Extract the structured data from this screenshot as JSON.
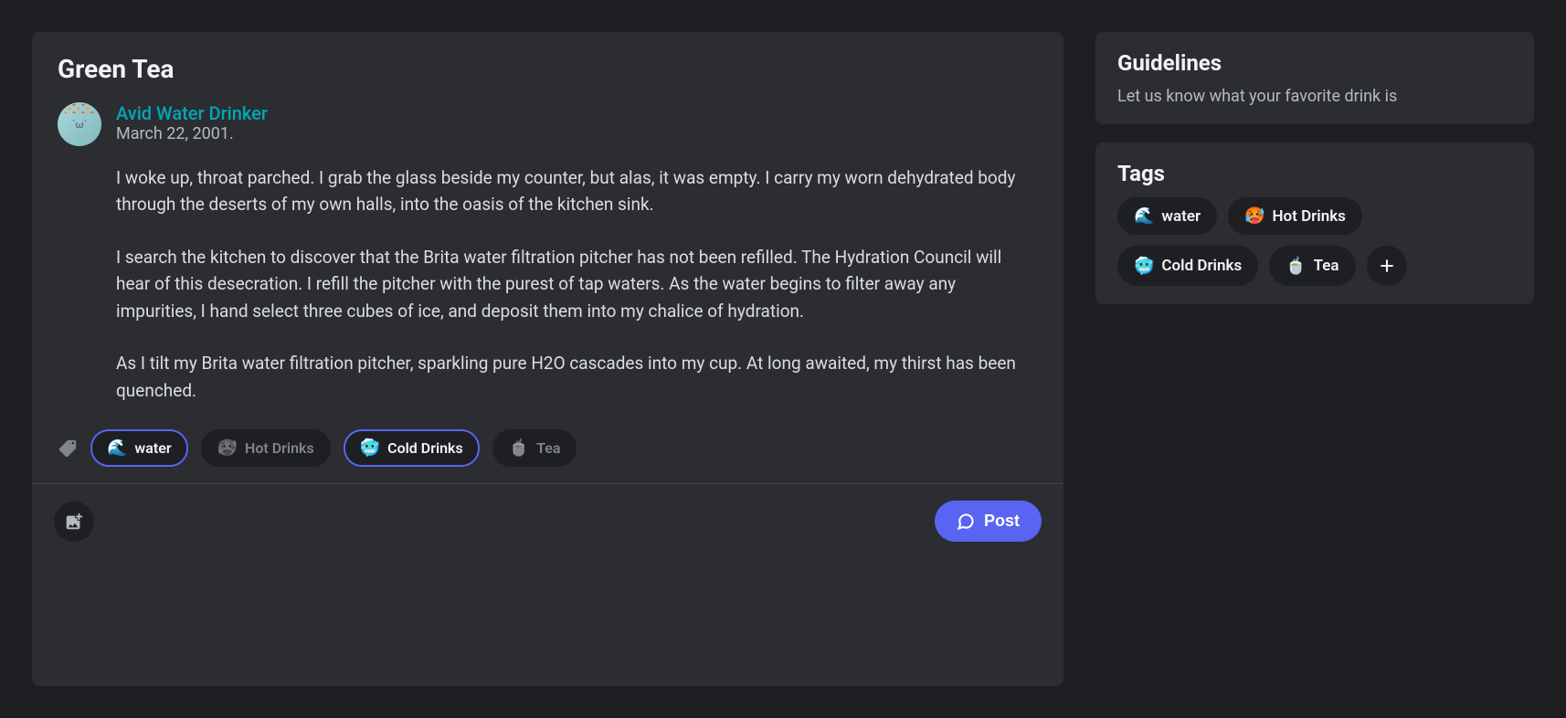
{
  "post": {
    "title": "Green Tea",
    "author": "Avid Water Drinker",
    "date": "March 22, 2001.",
    "paragraphs": [
      "I woke up, throat parched. I grab the glass beside my counter, but alas, it was empty. I carry my worn dehydrated body through the deserts of my own halls, into the oasis of the kitchen sink.",
      "I search the kitchen to discover that the Brita water filtration pitcher has not been refilled. The Hydration Council will hear of this desecration. I refill the pitcher with the purest of tap waters. As the water begins to filter away any impurities, I hand select three cubes of ice, and deposit them into my chalice of hydration.",
      "As I tilt my Brita water filtration pitcher, sparkling pure H2O cascades into my cup. At long awaited, my thirst has been quenched."
    ],
    "tags": [
      {
        "emoji": "🌊",
        "label": "water",
        "selected": true
      },
      {
        "emoji": "🥵",
        "label": "Hot Drinks",
        "selected": false
      },
      {
        "emoji": "🥶",
        "label": "Cold Drinks",
        "selected": true
      },
      {
        "emoji": "🍵",
        "label": "Tea",
        "selected": false
      }
    ]
  },
  "footer": {
    "post_button": "Post"
  },
  "guidelines": {
    "title": "Guidelines",
    "text": "Let us know what your favorite drink is"
  },
  "tags_panel": {
    "title": "Tags",
    "tags": [
      {
        "emoji": "🌊",
        "label": "water"
      },
      {
        "emoji": "🥵",
        "label": "Hot Drinks"
      },
      {
        "emoji": "🥶",
        "label": "Cold Drinks"
      },
      {
        "emoji": "🍵",
        "label": "Tea"
      }
    ]
  }
}
